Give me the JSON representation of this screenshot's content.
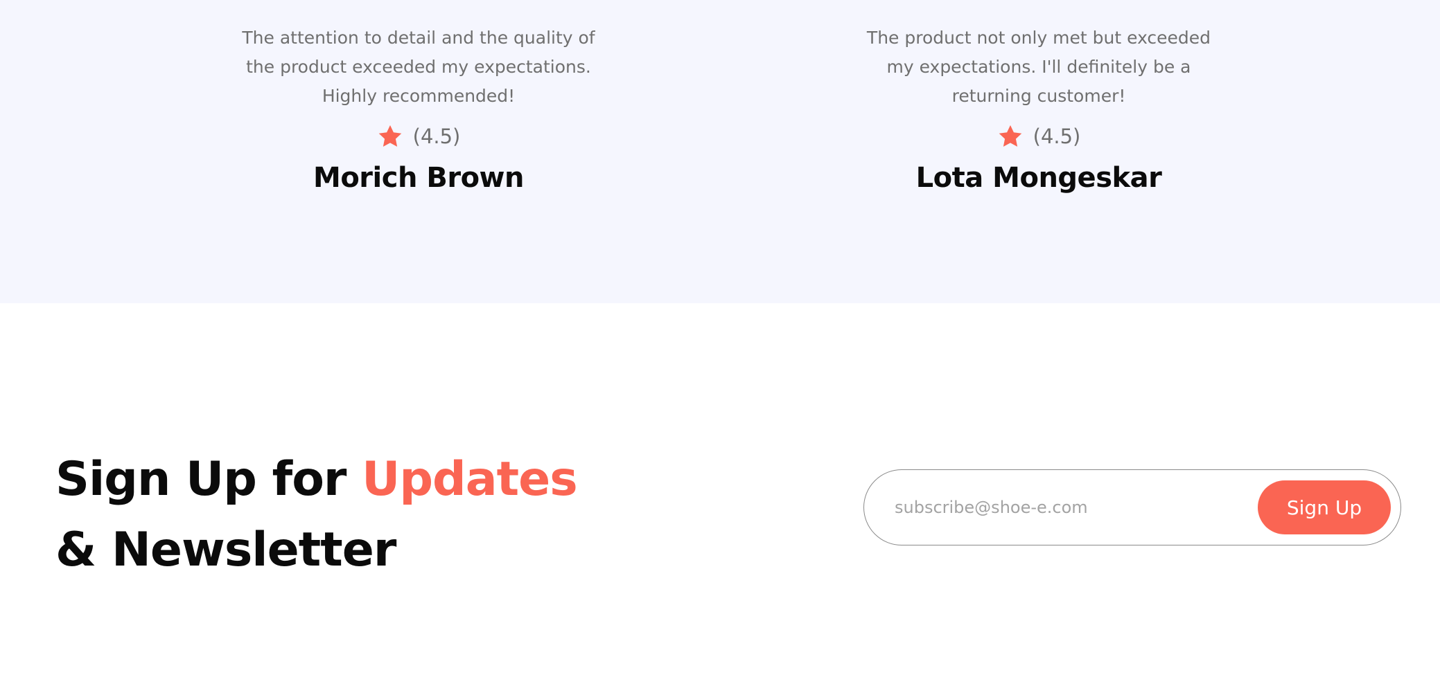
{
  "colors": {
    "accent": "#fa6553",
    "testimonials_bg": "#f5f6fe",
    "text_muted": "#6f6f6f",
    "text_dark": "#0b0b0b"
  },
  "testimonials": [
    {
      "text_lines": [
        "The attention to detail and the quality of",
        "the product exceeded my expectations.",
        "Highly recommended!"
      ],
      "rating_icon": "star-icon",
      "rating": "(4.5)",
      "name": "Morich Brown"
    },
    {
      "text_lines": [
        "The product not only met but exceeded",
        "my expectations. I'll definitely be a",
        "returning customer!"
      ],
      "rating_icon": "star-icon",
      "rating": "(4.5)",
      "name": "Lota Mongeskar"
    }
  ],
  "newsletter": {
    "heading_part1": "Sign Up for ",
    "heading_accent": "Updates",
    "heading_part2": "& Newsletter",
    "email_placeholder": "subscribe@shoe-e.com",
    "email_value": "",
    "button_label": "Sign Up"
  }
}
